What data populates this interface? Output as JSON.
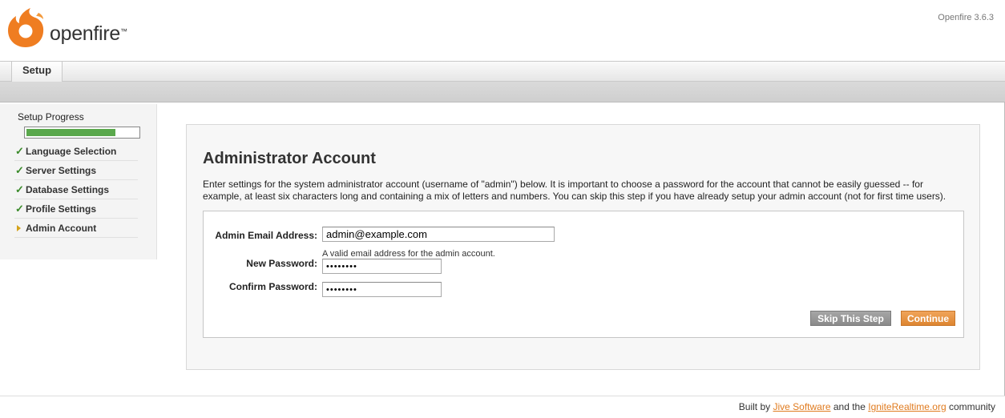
{
  "header": {
    "brand": "openfire",
    "trademark": "™",
    "version": "Openfire 3.6.3",
    "logo_icon": "openfire-flame-logo"
  },
  "tabs": [
    {
      "label": "Setup",
      "active": true
    }
  ],
  "sidebar": {
    "title": "Setup Progress",
    "progress": 0.8,
    "steps": [
      {
        "label": "Language Selection",
        "status": "complete"
      },
      {
        "label": "Server Settings",
        "status": "complete"
      },
      {
        "label": "Database Settings",
        "status": "complete"
      },
      {
        "label": "Profile Settings",
        "status": "complete"
      },
      {
        "label": "Admin Account",
        "status": "current"
      }
    ]
  },
  "main": {
    "title": "Administrator Account",
    "intro": "Enter settings for the system administrator account (username of \"admin\") below. It is important to choose a password for the account that cannot be easily guessed -- for example, at least six characters long and containing a mix of letters and numbers. You can skip this step if you have already setup your admin account (not for first time users).",
    "form": {
      "email_label": "Admin Email Address:",
      "email_value": "admin@example.com",
      "email_hint": "A valid email address for the admin account.",
      "password_label": "New Password:",
      "password_value": "••••••••",
      "confirm_label": "Confirm Password:",
      "confirm_value": "••••••••"
    },
    "buttons": {
      "skip": "Skip This Step",
      "continue": "Continue"
    }
  },
  "footer": {
    "prefix": "Built by",
    "link1": "Jive Software",
    "middle": "and the",
    "link2": "IgniteRealtime.org",
    "suffix": "community"
  },
  "colors": {
    "accent": "#e07b1f",
    "progress": "#5aa84c",
    "check": "#3a8a2a"
  }
}
